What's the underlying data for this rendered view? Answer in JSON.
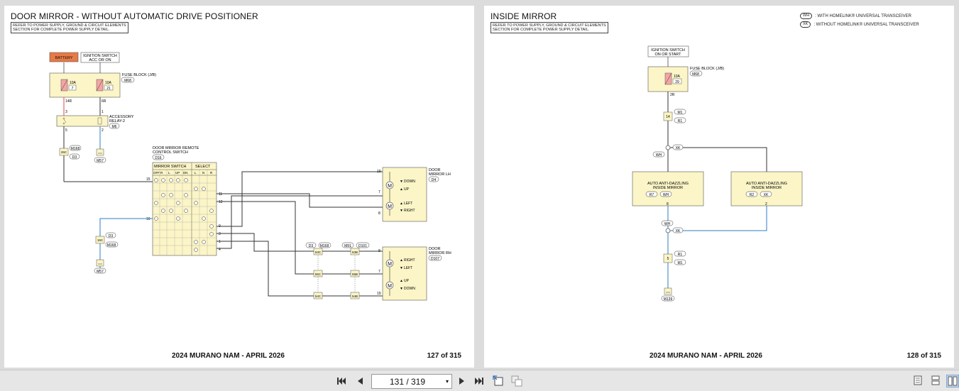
{
  "left_page": {
    "title": "DOOR MIRROR - WITHOUT AUTOMATIC DRIVE POSITIONER",
    "note": [
      "REFER TO POWER SUPPLY, GROUND & CIRCUIT ELEMENTS",
      "SECTION FOR COMPLETE POWER SUPPLY DETAIL."
    ],
    "footer": "2024 MURANO NAM - APRIL 2026",
    "page_number": "127 of 315",
    "labels": {
      "battery": "BATTERY",
      "ignition_1": "IGNITION SWITCH",
      "ignition_2": "ACC OR ON",
      "fuse_block": "FUSE BLOCK (J/B)",
      "fuse_conn": "M68",
      "fuse1_amp": "10A",
      "fuse1_num": "7",
      "fuse2_amp": "10A",
      "fuse2_num": "21",
      "wire_14r": "14R",
      "wire_6r": "6R",
      "pin_3": "3",
      "pin_1": "1",
      "pin_5": "5",
      "pin_2": "2",
      "relay_1": "ACCESSORY",
      "relay_2": "RELAY-2",
      "relay_conn": "M6",
      "jc_26c": "26C",
      "conn_m168a": "M168",
      "conn_d3a": "D3",
      "ground_m57a": "M57",
      "switch_1": "DOOR MIRROR REMOTE",
      "switch_2": "CONTROL SWITCH",
      "switch_conn": "D16",
      "mirror_switch": "MIRROR SWITCH",
      "select": "SELECT",
      "col_off": "OFF",
      "col_r": "R",
      "col_l": "L",
      "col_up": "UP",
      "col_dn": "DN",
      "col_sl": "L",
      "col_sn": "N",
      "col_sr": "R",
      "pin_15": "15",
      "pin_10": "10",
      "pin_11": "11",
      "pin_12": "12",
      "pin_9": "9",
      "pin_3b": "3",
      "pin_1b": "1",
      "pin_4": "4",
      "jc_15c": "15C",
      "conn_d3b": "D3",
      "conn_m168b": "M168",
      "ground_m57b": "M57",
      "lh_1": "DOOR",
      "lh_2": "MIRROR LH",
      "lh_conn": "D4",
      "lh_pin19": "19",
      "lh_pin7": "7",
      "lh_pin8": "8",
      "down": "DOWN",
      "up": "UP",
      "left": "LEFT",
      "right": "RIGHT",
      "rh_1": "DOOR",
      "rh_2": "MIRROR RH",
      "rh_conn": "D107",
      "rh_pin8": "8",
      "rh_pin7": "7",
      "rh_pin19": "19",
      "right2": "RIGHT",
      "left2": "LEFT",
      "up2": "UP",
      "down2": "DOWN",
      "conn_d3c": "D3",
      "conn_m168c": "M168",
      "conn_m91": "M91",
      "conn_d101": "D101",
      "jc_53c": "53C",
      "jc_55c": "55C",
      "jc_54c": "54C",
      "jc_53b": "53B",
      "jc_55b": "55B",
      "jc_54b": "54B",
      "motor": "M"
    }
  },
  "right_page": {
    "title": "INSIDE MIRROR",
    "note": [
      "REFER TO POWER SUPPLY, GROUND & CIRCUIT ELEMENTS",
      "SECTION FOR COMPLETE POWER SUPPLY DETAIL."
    ],
    "legend": [
      {
        "code": "WH",
        "text": ": WITH HOMELINK® UNIVERSAL TRANSCEIVER"
      },
      {
        "code": "XK",
        "text": ": WITHOUT HOMELINK® UNIVERSAL TRANSCEIVER"
      }
    ],
    "footer": "2024 MURANO NAM - APRIL 2026",
    "page_number": "128 of 315",
    "labels": {
      "ignition_1": "IGNITION SWITCH",
      "ignition_2": "ON OR START",
      "fuse_block": "FUSE BLOCK (J/B)",
      "fuse_conn": "M68",
      "fuse_amp": "10A",
      "fuse_num": "29",
      "wire_2r": "2R",
      "jc_14": "14",
      "conn_m1a": "M1",
      "conn_r1a": "R1",
      "xk_a": "XK",
      "wh_a": "WH",
      "pin_6": "6",
      "pin_1": "1",
      "mirror_a1": "AUTO ANTI-DAZZLING",
      "mirror_a2": "INSIDE MIRROR",
      "mirror_a_conn": "R7",
      "mirror_a_code": "WH",
      "mirror_b1": "AUTO ANTI-DAZZLING",
      "mirror_b2": "INSIDE MIRROR",
      "mirror_b_conn": "R2",
      "mirror_b_code": "XK",
      "pin_8": "8",
      "pin_2": "2",
      "wh_b": "WH",
      "xk_b": "XK",
      "jc_5": "5",
      "conn_r1b": "R1",
      "conn_m1b": "M1",
      "ground": "M139"
    }
  },
  "toolbar": {
    "page_indicator": "131 / 319",
    "first_icon": "first-page-icon",
    "prev_icon": "prev-page-icon",
    "next_icon": "next-page-icon",
    "last_icon": "last-page-icon"
  }
}
